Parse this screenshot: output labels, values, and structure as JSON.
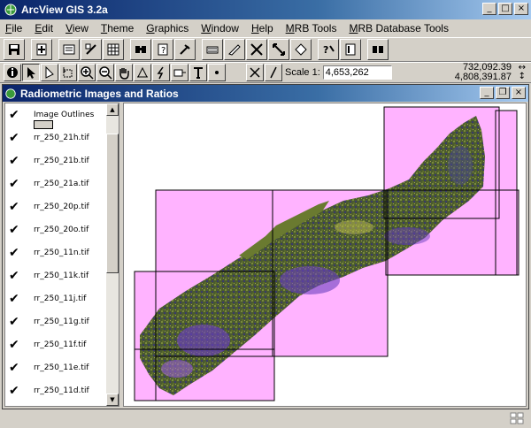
{
  "app": {
    "title": "ArcView GIS 3.2a",
    "colors": {
      "title_gradient_start": "#0a246a",
      "title_gradient_end": "#a6caf0",
      "image_footprint": "#ffb3ff"
    }
  },
  "menu": [
    "File",
    "Edit",
    "View",
    "Theme",
    "Graphics",
    "Window",
    "Help",
    "MRB Tools",
    "MRB Database Tools"
  ],
  "toolbar1": {
    "icons": [
      "save-icon",
      "add-theme-icon",
      "theme-properties-icon",
      "edit-legend-icon",
      "open-table-icon",
      "find-icon",
      "query-builder-icon",
      "hot-link-icon",
      "select-by-theme-icon",
      "clear-selection-icon",
      "zoom-to-themes-icon",
      "zoom-to-full-extent-icon",
      "zoom-previous-icon",
      "help-icon",
      "layout-icon",
      "binoculars-icon"
    ]
  },
  "toolbar2": {
    "icons": [
      "identify-icon",
      "pointer-icon",
      "vertex-edit-icon",
      "select-feature-icon",
      "zoom-in-icon",
      "zoom-out-icon",
      "pan-icon",
      "measure-icon",
      "hot-link-tool-icon",
      "label-icon",
      "text-icon",
      "draw-point-icon",
      "snap-icon",
      "general-snap-icon"
    ],
    "scale_label": "Scale  1:",
    "scale_value": "4,653,262",
    "coord_x": "732,092.39",
    "coord_y": "4,808,391.87"
  },
  "view": {
    "title": "Radiometric Images and Ratios",
    "themes": [
      {
        "label": "Image Outlines",
        "checked": "✔"
      },
      {
        "label": "rr_250_21h.tif",
        "checked": "✔"
      },
      {
        "label": "rr_250_21b.tif",
        "checked": "✔"
      },
      {
        "label": "rr_250_21a.tif",
        "checked": "✔"
      },
      {
        "label": "rr_250_20p.tif",
        "checked": "✔"
      },
      {
        "label": "rr_250_20o.tif",
        "checked": "✔"
      },
      {
        "label": "rr_250_11n.tif",
        "checked": "✔"
      },
      {
        "label": "rr_250_11k.tif",
        "checked": "✔"
      },
      {
        "label": "rr_250_11j.tif",
        "checked": "✔"
      },
      {
        "label": "rr_250_11g.tif",
        "checked": "✔"
      },
      {
        "label": "rr_250_11f.tif",
        "checked": "✔"
      },
      {
        "label": "rr_250_11e.tif",
        "checked": "✔"
      },
      {
        "label": "rr_250_11d.tif",
        "checked": "✔"
      }
    ]
  }
}
